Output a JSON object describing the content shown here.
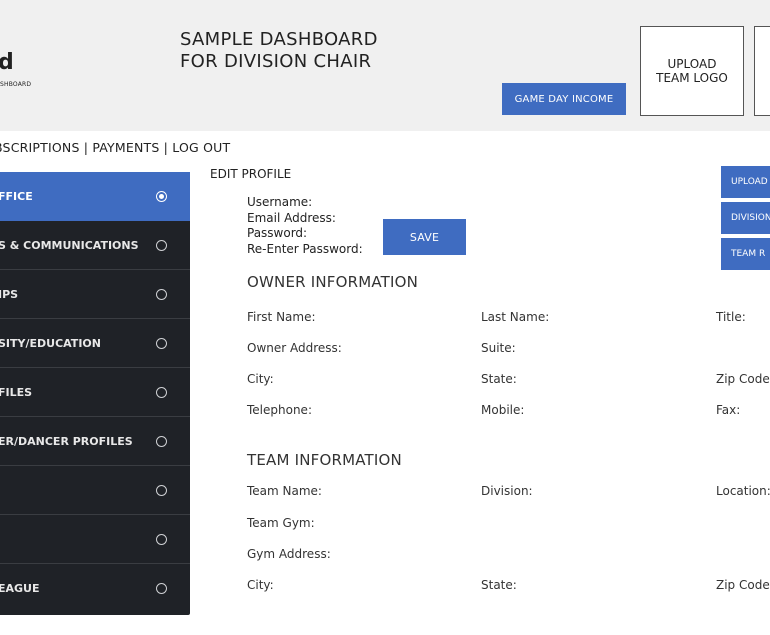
{
  "header": {
    "logo_letter": "d",
    "logo_subtext": "SHBOARD",
    "title_line1": "SAMPLE DASHBOARD",
    "title_line2": "FOR DIVISION CHAIR",
    "game_day_income": "GAME DAY INCOME",
    "upload_team_logo_line1": "UPLOAD",
    "upload_team_logo_line2": "TEAM LOGO"
  },
  "nav": {
    "text": "BSCRIPTIONS | PAYMENTS | LOG OUT"
  },
  "sidebar": {
    "items": [
      {
        "label": "FFICE",
        "active": true
      },
      {
        "label": "S & COMMUNICATIONS",
        "active": false
      },
      {
        "label": "IPS",
        "active": false
      },
      {
        "label": "SITY/EDUCATION",
        "active": false
      },
      {
        "label": "FILES",
        "active": false
      },
      {
        "label": "ER/DANCER PROFILES",
        "active": false
      },
      {
        "label": "",
        "active": false
      },
      {
        "label": "",
        "active": false
      },
      {
        "label": "EAGUE",
        "active": false
      }
    ]
  },
  "profile": {
    "heading": "EDIT PROFILE",
    "username": "Username:",
    "email": "Email Address:",
    "password": "Password:",
    "reenter": "Re-Enter Password:",
    "save": "SAVE"
  },
  "right_buttons": [
    "UPLOAD",
    "DIVISION",
    "TEAM R"
  ],
  "owner": {
    "heading": "OWNER INFORMATION",
    "first_name": "First Name:",
    "last_name": "Last Name:",
    "title": "Title:",
    "address": "Owner Address:",
    "suite": "Suite:",
    "city": "City:",
    "state": "State:",
    "zip": "Zip Code:",
    "telephone": "Telephone:",
    "mobile": "Mobile:",
    "fax": "Fax:"
  },
  "team": {
    "heading": "TEAM INFORMATION",
    "team_name": "Team Name:",
    "division": "Division:",
    "location": "Location:",
    "gym": "Team Gym:",
    "gym_address": "Gym Address:",
    "city": "City:",
    "state": "State:",
    "zip": "Zip Code:"
  },
  "colors": {
    "accent": "#3f6cc1",
    "sidebar_bg": "#1f2227",
    "header_bg": "#f0f0f0"
  }
}
